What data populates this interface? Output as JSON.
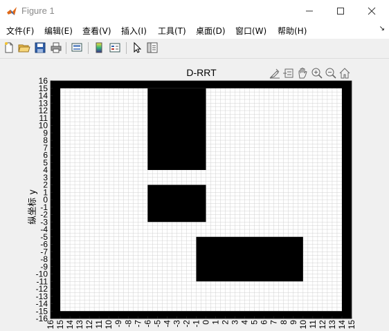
{
  "window": {
    "title": "Figure 1",
    "minimize_icon": "minimize-icon",
    "maximize_icon": "maximize-icon",
    "close_icon": "close-icon"
  },
  "menu": {
    "items": [
      "文件(F)",
      "编辑(E)",
      "查看(V)",
      "插入(I)",
      "工具(T)",
      "桌面(D)",
      "窗口(W)",
      "帮助(H)"
    ]
  },
  "toolbar": {
    "icons": [
      "new-figure-icon",
      "open-file-icon",
      "save-icon",
      "print-icon",
      "link-plot-icon",
      "insert-colorbar-icon",
      "insert-legend-icon",
      "edit-plot-icon",
      "property-inspector-icon"
    ]
  },
  "axes_toolbar": {
    "icons": [
      "brush-icon",
      "data-tips-icon",
      "pan-icon",
      "zoom-in-icon",
      "zoom-out-icon",
      "restore-view-icon"
    ]
  },
  "chart_data": {
    "type": "heatmap",
    "title": "D-RRT",
    "xlabel": "",
    "ylabel": "纵坐标 y",
    "xlim": [
      -16,
      15
    ],
    "ylim": [
      -16,
      16
    ],
    "x_ticks": [
      "16",
      "15",
      "14",
      "13",
      "12",
      "11",
      "10",
      "-9",
      "-8",
      "-7",
      "-6",
      "-5",
      "-4",
      "-3",
      "-2",
      "-1",
      "0",
      "1",
      "2",
      "3",
      "4",
      "5",
      "6",
      "7",
      "8",
      "9",
      "10",
      "11",
      "12",
      "13",
      "14",
      "15"
    ],
    "y_ticks": [
      "16",
      "15",
      "14",
      "13",
      "12",
      "11",
      "10",
      "9",
      "8",
      "7",
      "6",
      "5",
      "4",
      "3",
      "2",
      "1",
      "0",
      "-1",
      "-2",
      "-3",
      "-4",
      "-5",
      "-6",
      "-7",
      "-8",
      "-9",
      "-10",
      "-11",
      "-12",
      "-13",
      "-14",
      "-15",
      "-16"
    ],
    "grid": true,
    "colors": {
      "obstacle": "#000000",
      "free": "#ffffff",
      "grid": "#d0d0d0"
    },
    "border": {
      "x_inner": [
        -15,
        14
      ],
      "y_inner": [
        -15,
        15
      ]
    },
    "obstacles": [
      {
        "x": [
          -6,
          0
        ],
        "y": [
          4,
          15
        ]
      },
      {
        "x": [
          -6,
          0
        ],
        "y": [
          -3,
          2
        ]
      },
      {
        "x": [
          -1,
          10
        ],
        "y": [
          -11,
          -5
        ]
      }
    ]
  }
}
